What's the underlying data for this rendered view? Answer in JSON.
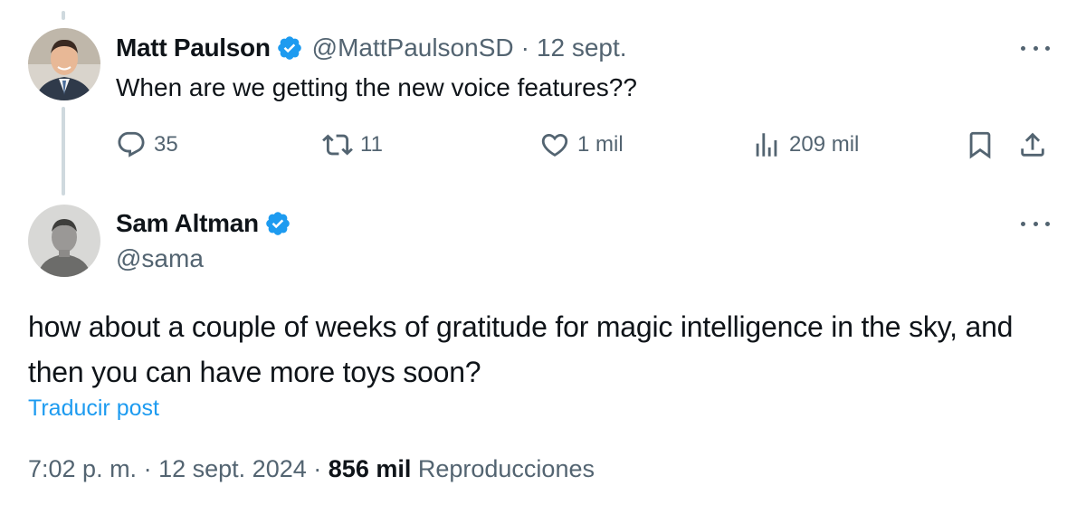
{
  "parent_tweet": {
    "author_name": "Matt Paulson",
    "handle": "@MattPaulsonSD",
    "separator": "·",
    "date": "12 sept.",
    "text": "When are we getting the new voice features??",
    "actions": {
      "replies": "35",
      "reposts": "11",
      "likes": "1 mil",
      "views": "209 mil"
    }
  },
  "main_tweet": {
    "author_name": "Sam Altman",
    "handle": "@sama",
    "text": "how about a couple of weeks of gratitude for magic intelligence in the sky, and then you can have more toys soon?",
    "translate_link": "Traducir post",
    "time": "7:02 p. m.",
    "separator": "·",
    "date": "12 sept. 2024",
    "views_count": "856 mil",
    "views_label": "Reproducciones"
  },
  "colors": {
    "verified_blue": "#1d9bf0",
    "secondary_text": "#536471",
    "primary_text": "#0f1419",
    "link": "#1d9bf0"
  },
  "icons": {
    "verified": "verified-badge-icon",
    "more": "more-icon",
    "reply": "reply-icon",
    "retweet": "retweet-icon",
    "like": "heart-icon",
    "views": "views-icon",
    "bookmark": "bookmark-icon",
    "share": "share-icon"
  }
}
